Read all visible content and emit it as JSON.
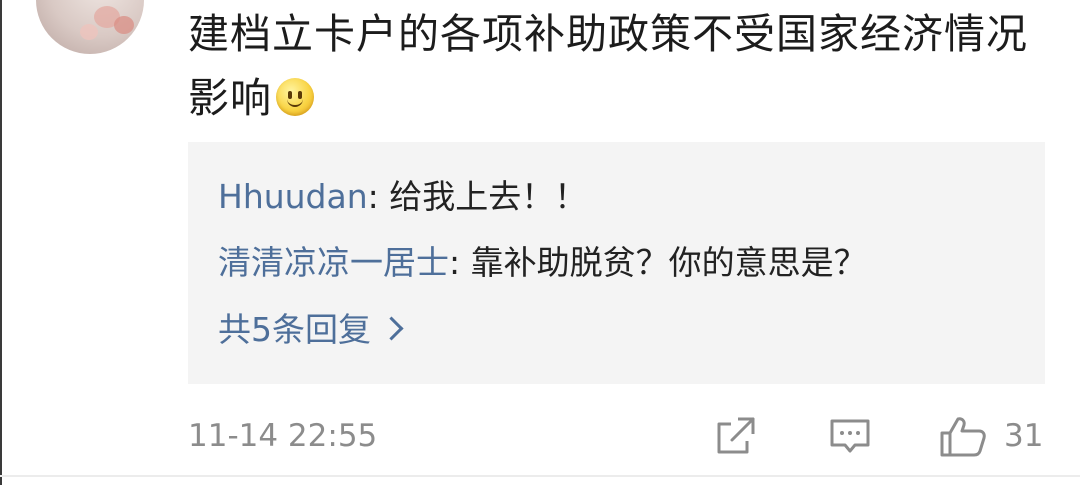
{
  "comment": {
    "text": "建档立卡户的各项补助政策不受国家经济情况影响",
    "emoji": "smiley-emoji"
  },
  "replies": [
    {
      "user": "Hhuudan",
      "separator": ": ",
      "text": "给我上去！！"
    },
    {
      "user": "清清凉凉一居士",
      "separator": ": ",
      "text": "靠补助脱贫？你的意思是？"
    }
  ],
  "more_replies_label": "共5条回复",
  "meta": {
    "timestamp": "11-14 22:55",
    "like_count": "31"
  },
  "icons": {
    "share": "share-icon",
    "reply": "comment-icon",
    "like": "thumbs-up-icon",
    "more": "chevron-right-icon"
  },
  "colors": {
    "link": "#4e6f9a",
    "muted": "#8c8c8c",
    "reply_bg": "#f4f4f4"
  }
}
